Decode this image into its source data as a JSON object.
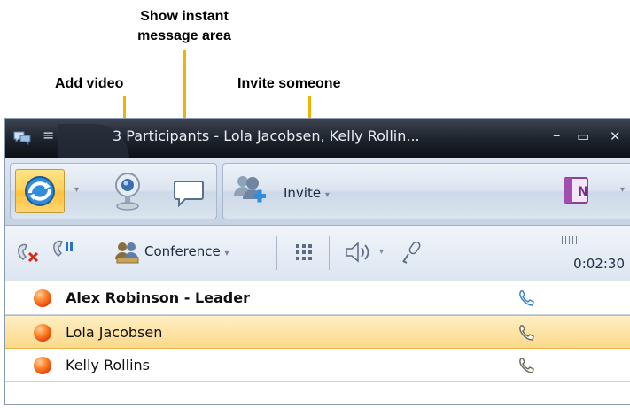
{
  "callouts": {
    "show_im": "Show instant\nmessage area",
    "add_video": "Add video",
    "invite_someone": "Invite someone"
  },
  "window": {
    "title": "3 Participants - Lola Jacobsen, Kelly Rollin...",
    "minimize_glyph": "–",
    "maximize_glyph": "▭",
    "close_glyph": "✕"
  },
  "toolbar": {
    "invite_label": "Invite",
    "dropdown_glyph": "▾"
  },
  "call_controls": {
    "conference_label": "Conference",
    "timer": "0:02:30",
    "signal_bars": "|||||"
  },
  "participants": [
    {
      "name": "Alex Robinson - Leader",
      "bold": true,
      "selected": false
    },
    {
      "name": "Lola Jacobsen",
      "bold": false,
      "selected": true
    },
    {
      "name": "Kelly Rollins",
      "bold": false,
      "selected": false
    }
  ],
  "colors": {
    "accent_yellow": "#f0b400",
    "presence_busy": "#e94c0c",
    "title_bar": "#1d232c"
  },
  "icons": {
    "call": "call-icon",
    "video": "webcam-icon",
    "im": "speech-bubble-icon",
    "invite": "add-people-icon",
    "onenote": "onenote-icon",
    "end_call": "end-call-icon",
    "hold": "hold-call-icon",
    "conference": "conference-icon",
    "dialpad": "dialpad-icon",
    "speaker": "speaker-icon",
    "mic": "microphone-icon",
    "phone": "phone-icon"
  }
}
